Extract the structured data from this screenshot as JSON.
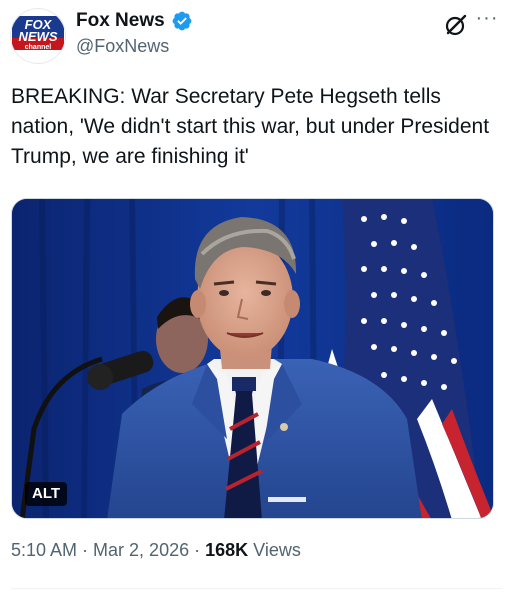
{
  "author": {
    "display_name": "Fox News",
    "handle": "@FoxNews",
    "avatar_icon": "fox-news-channel-logo",
    "avatar_text_top": "FOX",
    "avatar_text_mid": "NEWS",
    "avatar_text_bottom": "channel",
    "verified_icon": "verified-badge-icon",
    "verified_color": "#1d9bf0"
  },
  "actions": {
    "grok_icon": "grok-icon",
    "more_icon": "more-options-icon",
    "more_label": "···"
  },
  "tweet": {
    "text": "BREAKING: War Secretary Pete Hegseth tells nation, 'We didn't start this war, but under President Trump, we are finishing it'"
  },
  "media": {
    "alt_label": "ALT",
    "description_icon": "photo-man-suit-podium-flag"
  },
  "meta": {
    "time": "5:10 AM",
    "separator": "·",
    "date": "Mar 2, 2026",
    "views_count": "168K",
    "views_label": "Views"
  },
  "colors": {
    "text_primary": "#0f1419",
    "text_secondary": "#536471",
    "fox_red": "#c4161c",
    "fox_blue": "#1a3a8f"
  }
}
